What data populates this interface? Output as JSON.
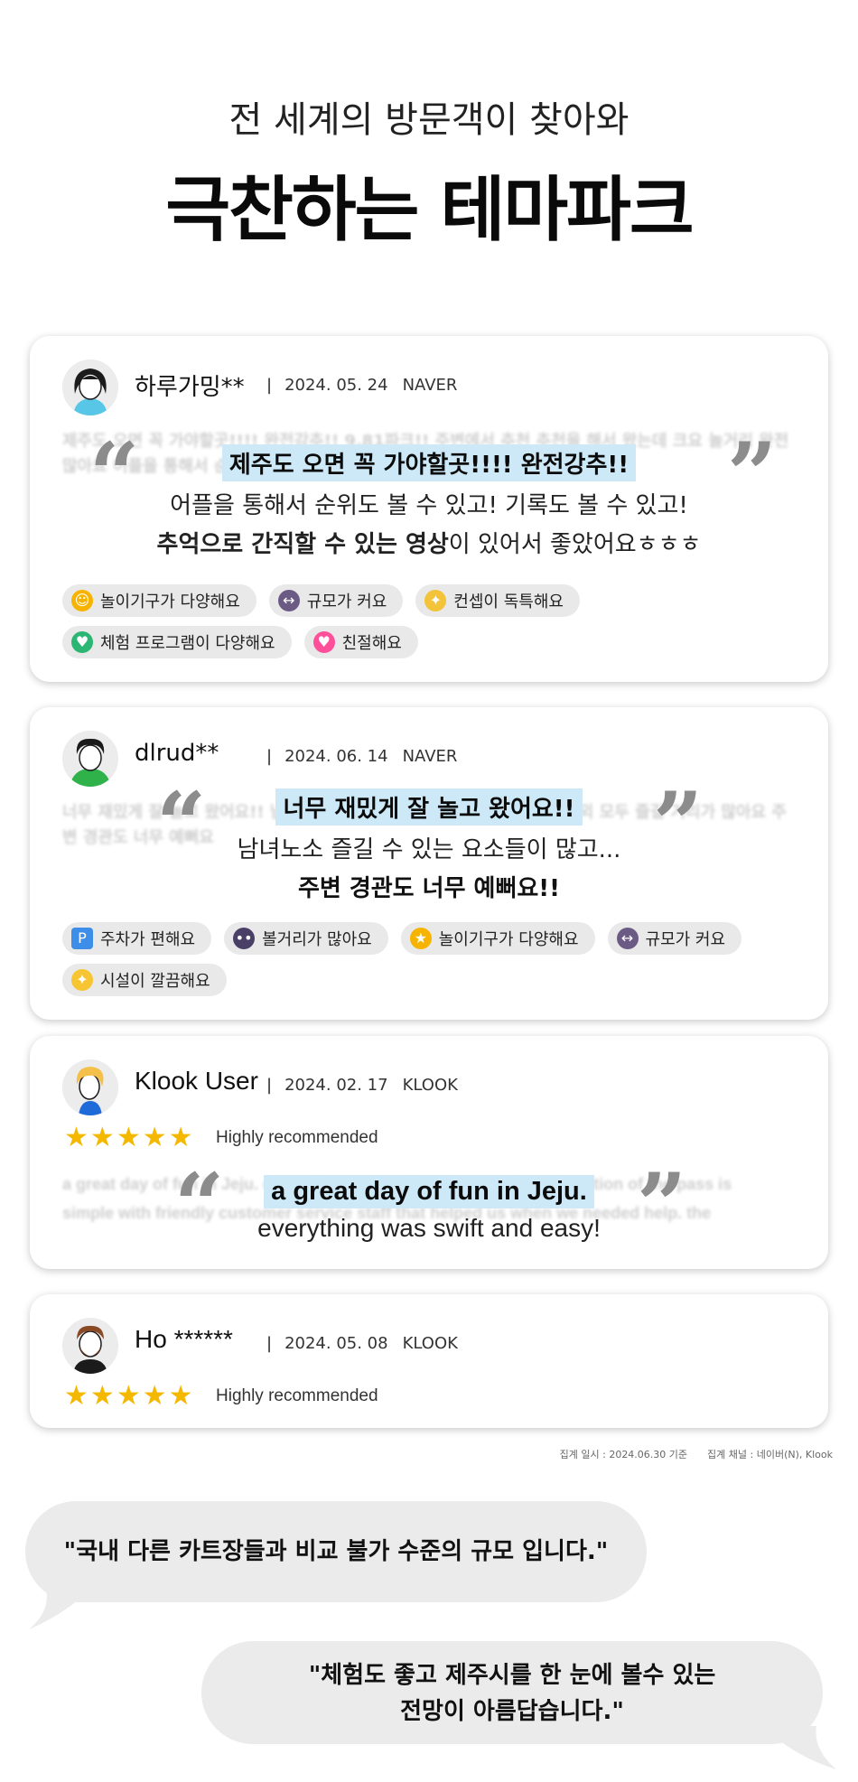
{
  "hero": {
    "subtitle": "전 세계의 방문객이 찾아와",
    "title": "극찬하는 테마파크"
  },
  "reviews": [
    {
      "user": "하루가밍**",
      "date": "2024. 05. 24",
      "source": "NAVER",
      "avatar": "woman-avatar-icon",
      "blurred": "제주도 오면 꼭 가야할곳!!!! 완전강추!! 9.81파크!! 주변에서 추천 추천을 해서 왔는데 크요 놀거리 완전 많아요 어플을 통해서 순위도 볼 수 있고 기록도 볼 수 있고 저의 모습",
      "highlight": "제주도 오면 꼭 가야할곳!!!! 완전강추!!",
      "line1": "어플을 통해서 순위도 볼 수 있고! 기록도 볼 수 있고!",
      "line2_bold": "추억으로 간직할 수 있는 영상",
      "line2_rest": "이 있어서 좋았어요ㅎㅎㅎ",
      "tags": [
        {
          "icon": "smiling-face-icon",
          "color": "#f6b400",
          "label": "놀이기구가 다양해요"
        },
        {
          "icon": "left-right-arrow-icon",
          "color": "#6b5b84",
          "label": "규모가 커요"
        },
        {
          "icon": "lightbulb-icon",
          "color": "#f3c43a",
          "label": "컨셉이 독특해요"
        },
        {
          "icon": "green-heart-icon",
          "color": "#2bb673",
          "label": "체험 프로그램이 다양해요"
        },
        {
          "icon": "pink-heart-icon",
          "color": "#ff4f9a",
          "label": "친절해요"
        }
      ]
    },
    {
      "user": "dlrud**",
      "date": "2024. 06. 14",
      "source": "NAVER",
      "avatar": "man-avatar-icon",
      "blurred": "너무 재밌게 잘 놀고 왔어요!! 남녀노소 즐길 수 있는 요소들이 많고 실내 실외 모두 즐길 거리가 많아요 주변 경관도 너무 예뻐요",
      "highlight": "너무 재밌게 잘 놀고 왔어요!!",
      "line1": "남녀노소 즐길 수 있는 요소들이 많고...",
      "line2_bold": "주변 경관도 너무 예뻐요!!",
      "line2_rest": "",
      "tags": [
        {
          "icon": "parking-icon",
          "color": "#3d8ee8",
          "label": "주차가 편해요"
        },
        {
          "icon": "eyes-icon",
          "color": "#4a3f66",
          "label": "볼거리가 많아요"
        },
        {
          "icon": "star-struck-face-icon",
          "color": "#f6b400",
          "label": "놀이기구가 다양해요"
        },
        {
          "icon": "left-right-arrow-icon",
          "color": "#6b5b84",
          "label": "규모가 커요"
        },
        {
          "icon": "sparkles-icon",
          "color": "#f7c531",
          "label": "시설이 깔끔해요"
        }
      ]
    },
    {
      "user": "Klook User",
      "date": "2024. 02. 17",
      "source": "KLOOK",
      "avatar": "blonde-avatar-icon",
      "rating": 5,
      "rating_label": "Highly recommended",
      "blurred_1": "a great day of fun in Jeju. everything was swift and easy! the redemption of the pass is",
      "blurred_2": "simple with friendly customer service staff that helped us when we needed help. the",
      "highlight": "a great day of fun in Jeju.",
      "line1": "everything was swift and easy!"
    },
    {
      "user": "Ho ******",
      "date": "2024. 05. 08",
      "source": "KLOOK",
      "avatar": "bearded-avatar-icon",
      "rating": 5,
      "rating_label": "Highly recommended"
    }
  ],
  "footnote": {
    "collected_at": "집계 일시 : 2024.06.30 기준",
    "collected_from": "집계 채널 : 네이버(N), Klook"
  },
  "bubbles": {
    "left": "\"국내 다른 카트장들과 비교 불가 수준의 규모 입니다.\"",
    "right_line1": "\"체험도 좋고 제주시를 한 눈에 볼수 있는",
    "right_line2": "전망이 아름답습니다.\""
  },
  "colors": {
    "highlight": "#cde9f7",
    "star": "#f5b800",
    "tag_bg": "#e9e9e9",
    "bubble_bg": "#ebebeb"
  }
}
